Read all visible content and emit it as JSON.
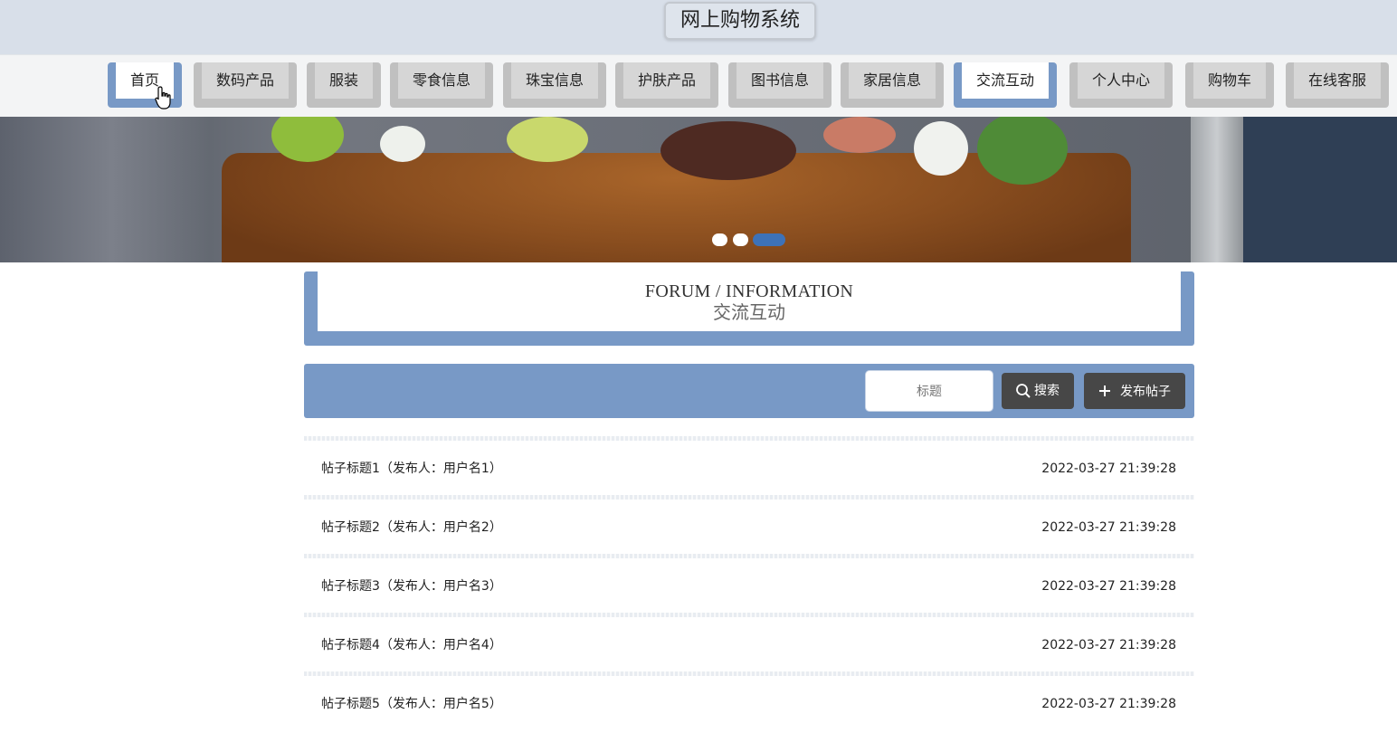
{
  "header": {
    "site_title": "网上购物系统"
  },
  "nav": {
    "items": [
      {
        "label": "首页"
      },
      {
        "label": "数码产品"
      },
      {
        "label": "服装"
      },
      {
        "label": "零食信息"
      },
      {
        "label": "珠宝信息"
      },
      {
        "label": "护肤产品"
      },
      {
        "label": "图书信息"
      },
      {
        "label": "家居信息"
      },
      {
        "label": "交流互动"
      },
      {
        "label": "个人中心"
      },
      {
        "label": "购物车"
      },
      {
        "label": "在线客服"
      }
    ],
    "active_items": [
      "首页",
      "交流互动"
    ],
    "accent_color": "#7899c6"
  },
  "banner": {
    "slide_count": 3,
    "active_slide": 3,
    "indicator_color": "#3d72b8"
  },
  "section": {
    "title_en": "FORUM / INFORMATION",
    "title_zh": "交流互动"
  },
  "search": {
    "placeholder": "标题",
    "search_label": "搜索",
    "post_label": "发布帖子",
    "search_icon": "magnifier-icon",
    "post_icon": "plus-icon"
  },
  "posts": [
    {
      "title": "帖子标题1（发布人：用户名1）",
      "time": "2022-03-27 21:39:28"
    },
    {
      "title": "帖子标题2（发布人：用户名2）",
      "time": "2022-03-27 21:39:28"
    },
    {
      "title": "帖子标题3（发布人：用户名3）",
      "time": "2022-03-27 21:39:28"
    },
    {
      "title": "帖子标题4（发布人：用户名4）",
      "time": "2022-03-27 21:39:28"
    },
    {
      "title": "帖子标题5（发布人：用户名5）",
      "time": "2022-03-27 21:39:28"
    }
  ]
}
